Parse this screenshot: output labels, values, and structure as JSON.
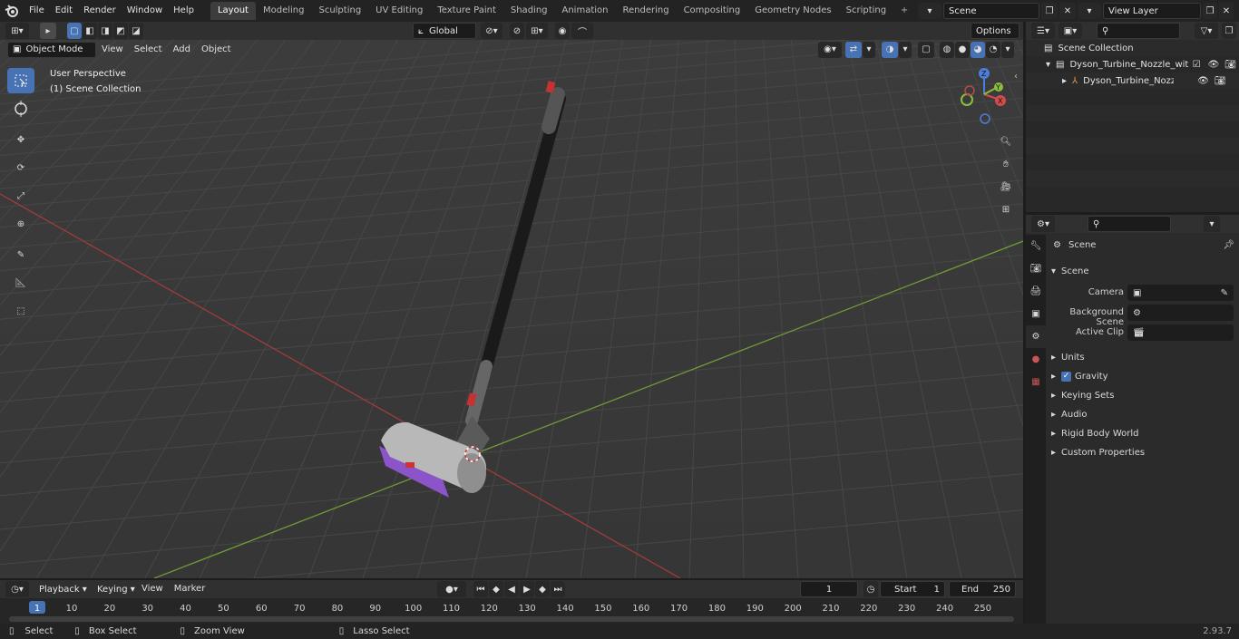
{
  "menus": [
    "File",
    "Edit",
    "Render",
    "Window",
    "Help"
  ],
  "workspaces": [
    "Layout",
    "Modeling",
    "Sculpting",
    "UV Editing",
    "Texture Paint",
    "Shading",
    "Animation",
    "Rendering",
    "Compositing",
    "Geometry Nodes",
    "Scripting"
  ],
  "active_workspace": "Layout",
  "scene_name": "Scene",
  "view_layer": "View Layer",
  "viewport": {
    "mode": "Object Mode",
    "menus": [
      "View",
      "Select",
      "Add",
      "Object"
    ],
    "orientation": "Global",
    "options_label": "Options",
    "info_line1": "User Perspective",
    "info_line2": "(1) Scene Collection"
  },
  "outliner": {
    "root": "Scene Collection",
    "collection": "Dyson_Turbine_Nozzle_with_T",
    "object": "Dyson_Turbine_Nozzle_w"
  },
  "properties": {
    "context": "Scene",
    "panel": "Scene",
    "camera_label": "Camera",
    "background_label": "Background Scene",
    "clip_label": "Active Clip",
    "sections": [
      "Units",
      "Gravity",
      "Keying Sets",
      "Audio",
      "Rigid Body World",
      "Custom Properties"
    ]
  },
  "timeline": {
    "menus": [
      "Playback",
      "Keying",
      "View",
      "Marker"
    ],
    "current_frame": "1",
    "start_label": "Start",
    "start_value": "1",
    "end_label": "End",
    "end_value": "250",
    "ticks": [
      "1",
      "10",
      "20",
      "30",
      "40",
      "50",
      "60",
      "70",
      "80",
      "90",
      "100",
      "110",
      "120",
      "130",
      "140",
      "150",
      "160",
      "170",
      "180",
      "190",
      "200",
      "210",
      "220",
      "230",
      "240",
      "250"
    ]
  },
  "statusbar": {
    "select": "Select",
    "box_select": "Box Select",
    "zoom": "Zoom View",
    "lasso": "Lasso Select",
    "version": "2.93.7"
  },
  "colors": {
    "accent": "#4772b3",
    "x_axis": "#b33a3a",
    "y_axis": "#7aa33a"
  }
}
